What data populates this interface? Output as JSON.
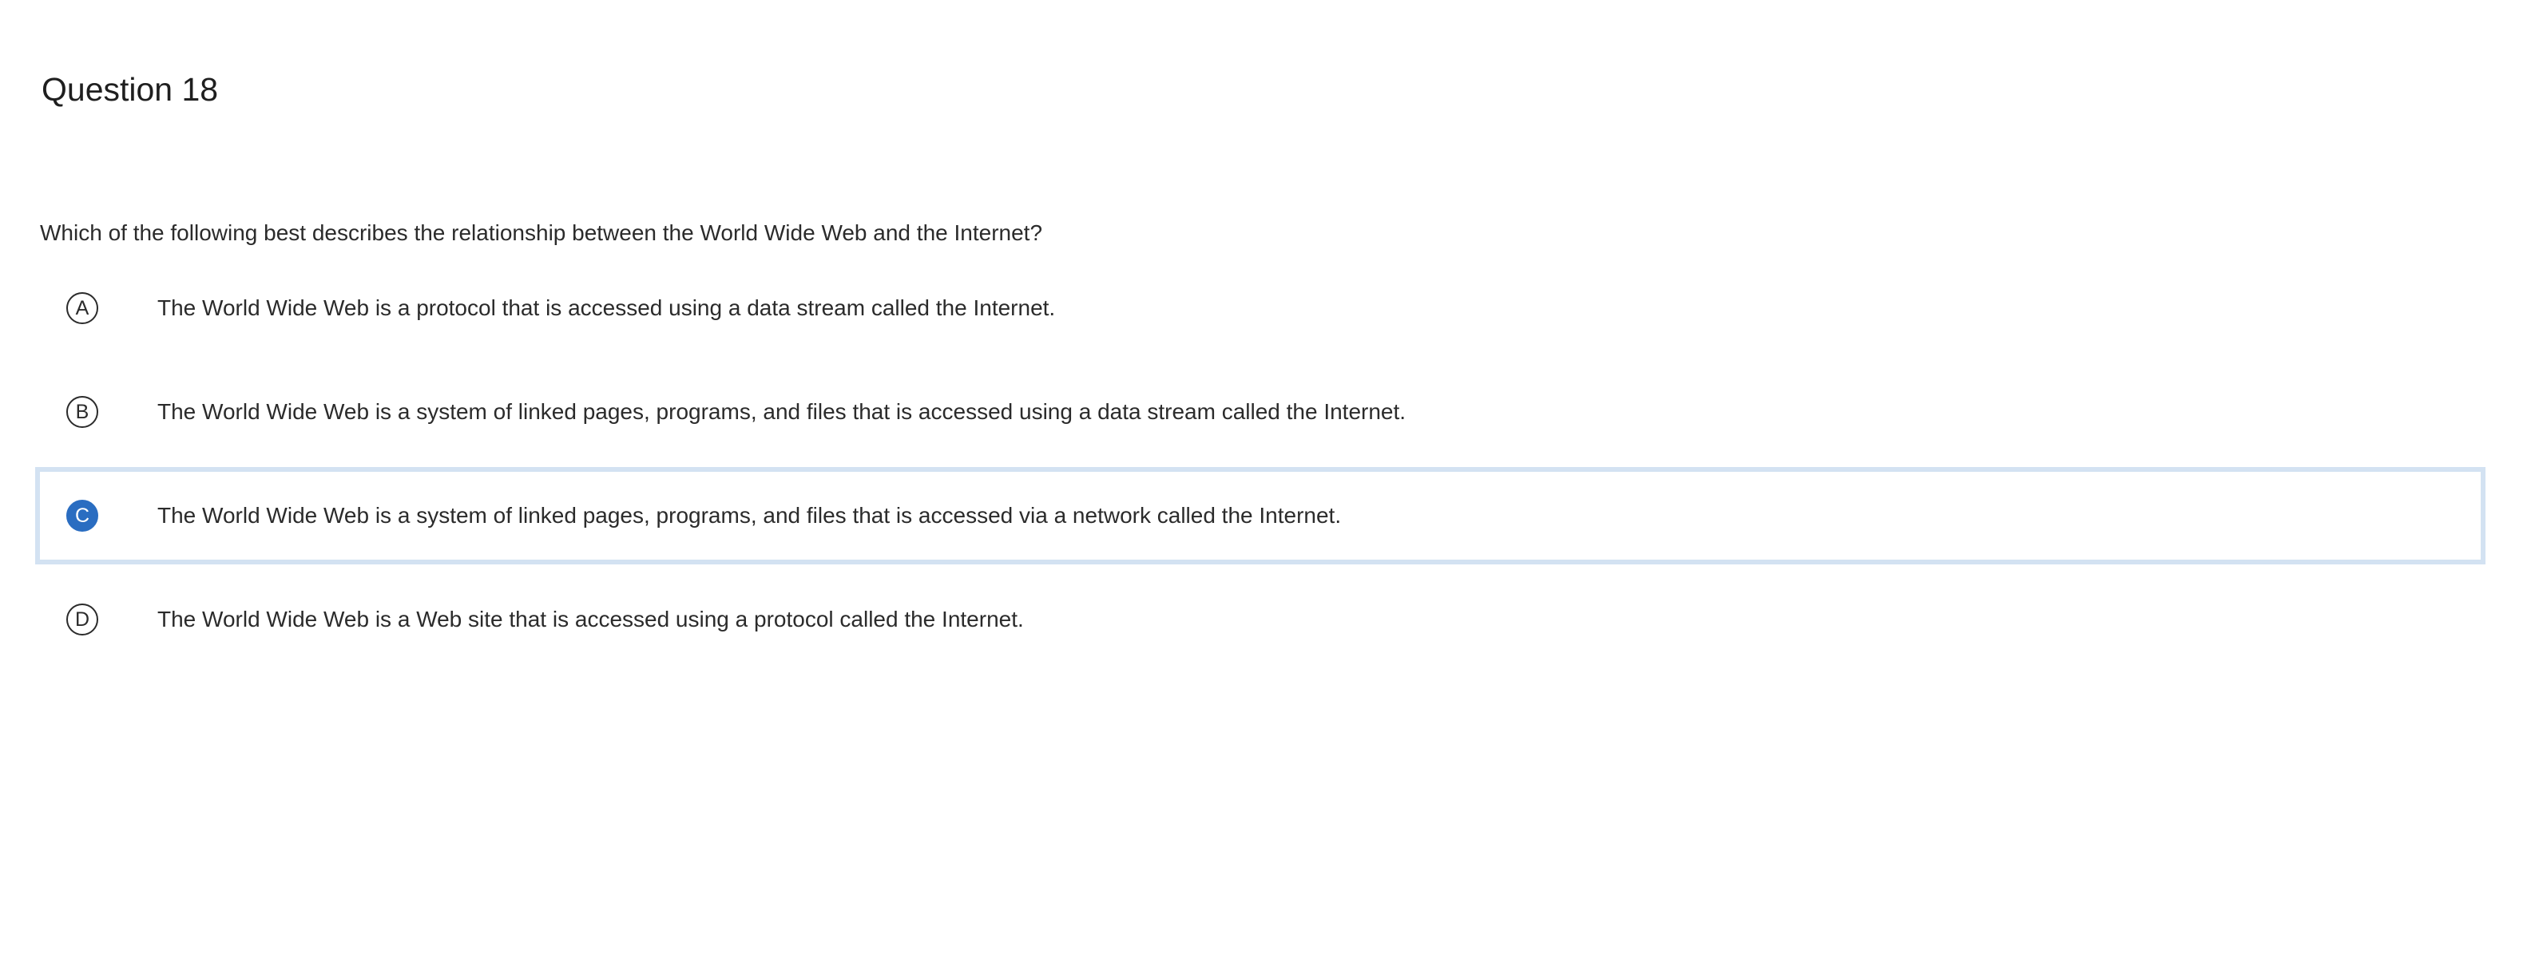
{
  "question": {
    "title": "Question 18",
    "stem": "Which of the following best describes the relationship between the World Wide Web and the Internet?"
  },
  "choices": [
    {
      "letter": "A",
      "text": "The World Wide Web is a protocol that is accessed using a data stream called the Internet.",
      "selected": false
    },
    {
      "letter": "B",
      "text": "The World Wide Web is a system of linked pages, programs, and files that is accessed using a data stream called the Internet.",
      "selected": false
    },
    {
      "letter": "C",
      "text": "The World Wide Web is a system of linked pages, programs, and files that is accessed via a network called the Internet.",
      "selected": true
    },
    {
      "letter": "D",
      "text": "The World Wide Web is a Web site that is accessed using a protocol called the Internet.",
      "selected": false
    }
  ],
  "colors": {
    "selected_fill": "#2a6dc1",
    "selected_border": "#d3e2f2",
    "text": "#2b2b2b"
  }
}
